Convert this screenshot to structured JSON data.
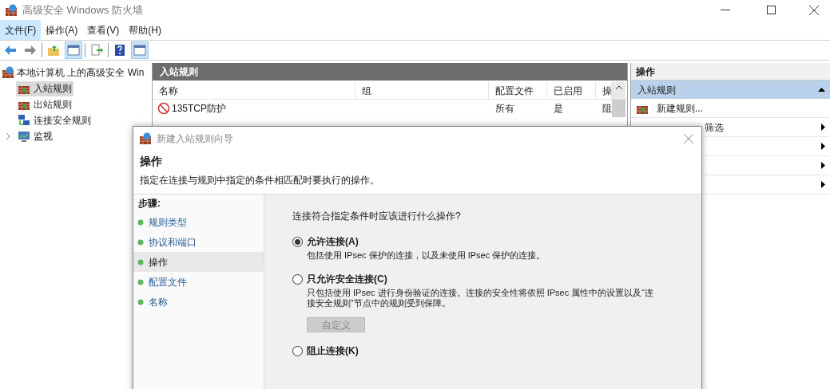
{
  "window": {
    "title": "高级安全 Windows 防火墙"
  },
  "menu": [
    {
      "label": "文件(F)",
      "selected": true
    },
    {
      "label": "操作(A)",
      "selected": false
    },
    {
      "label": "查看(V)",
      "selected": false
    },
    {
      "label": "帮助(H)",
      "selected": false
    }
  ],
  "tree": {
    "root": "本地计算机 上的高级安全 Win",
    "children": [
      {
        "label": "入站规则",
        "kind": "wall-in",
        "selected": true
      },
      {
        "label": "出站规则",
        "kind": "wall-out",
        "selected": false
      },
      {
        "label": "连接安全规则",
        "kind": "network",
        "selected": false
      },
      {
        "label": "监视",
        "kind": "monitor",
        "selected": false,
        "expanded": false
      }
    ]
  },
  "rules": {
    "title": "入站规则",
    "columns": [
      "名称",
      "组",
      "配置文件",
      "已启用",
      "操"
    ],
    "rows": [
      {
        "name": "135TCP防护",
        "profile": "所有",
        "enabled": "是",
        "action": "阻"
      }
    ]
  },
  "actions": {
    "title": "操作",
    "section": "入站规则",
    "items": [
      {
        "label": "新建规则...",
        "kind": "icon"
      },
      {
        "label": "筛选",
        "kind": "submenu"
      },
      {
        "kind": "submenu"
      },
      {
        "kind": "submenu"
      },
      {
        "kind": "submenu"
      }
    ]
  },
  "dialog": {
    "title": "新建入站规则向导",
    "heading": "操作",
    "description": "指定在连接与规则中指定的条件相匹配时要执行的操作。",
    "steps_title": "步骤:",
    "steps": [
      {
        "label": "规则类型",
        "selected": false
      },
      {
        "label": "协议和端口",
        "selected": false
      },
      {
        "label": "操作",
        "selected": true
      },
      {
        "label": "配置文件",
        "selected": false
      },
      {
        "label": "名称",
        "selected": false
      }
    ],
    "question": "连接符合指定条件时应该进行什么操作?",
    "options": [
      {
        "label": "允许连接(A)",
        "selected": true,
        "description": "包括使用 IPsec 保护的连接，以及未使用 IPsec 保护的连接。"
      },
      {
        "label": "只允许安全连接(C)",
        "selected": false,
        "description": "只包括使用 IPsec 进行身份验证的连接。连接的安全性将依照 IPsec 属性中的设置以及“连接安全规则”节点中的规则受到保障。",
        "button": {
          "label": "自定义",
          "disabled": true
        }
      },
      {
        "label": "阻止连接(K)",
        "selected": false
      }
    ]
  }
}
